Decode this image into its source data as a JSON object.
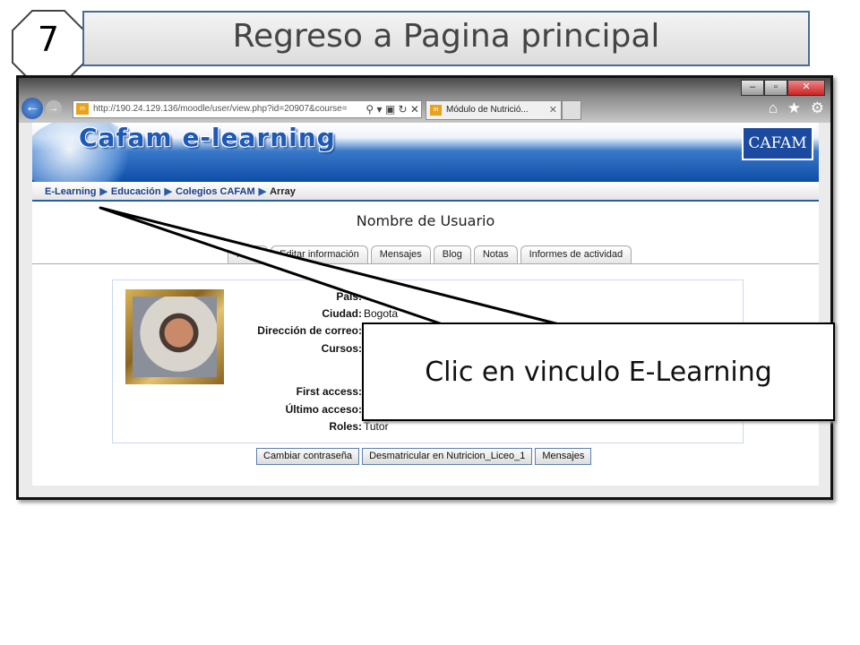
{
  "slide": {
    "step_number": "7",
    "title": "Regreso a Pagina principal",
    "callout": "Clic en vinculo E-Learning"
  },
  "browser": {
    "address": "http://190.24.129.136/moodle/user/view.php?id=20907&course=",
    "address_tools": "⚲ ▾ ▣ ↻ ✕",
    "site_icon": "favicon-icon",
    "tab_title": "Módulo de Nutrició...",
    "tab_close": "✕",
    "back_glyph": "←",
    "forward_glyph": "→",
    "right_tools": "⌂ ★ ⚙",
    "window_buttons": [
      "–",
      "▫",
      "✕"
    ]
  },
  "site": {
    "brand": "Cafam e-learning",
    "logo": "CAFAM",
    "breadcrumb": [
      "E-Learning",
      "Educación",
      "Colegios CAFAM",
      "Array"
    ],
    "breadcrumb_sep": "▶",
    "username": "Nombre de Usuario",
    "tabs": [
      "Perfil",
      "Editar información",
      "Mensajes",
      "Blog",
      "Notas",
      "Informes de actividad"
    ],
    "profile": {
      "fields": [
        {
          "label": "País:",
          "value": "Co"
        },
        {
          "label": "Ciudad:",
          "value": "Bogota"
        },
        {
          "label": "Dirección de correo:",
          "value": ""
        },
        {
          "label": "Cursos:",
          "value": ""
        },
        {
          "label": "First access:",
          "value": ""
        },
        {
          "label": "Último acceso:",
          "value": ""
        },
        {
          "label": "Roles:",
          "value": "Tutor"
        }
      ]
    },
    "buttons": [
      "Cambiar contraseña",
      "Desmatricular en Nutricion_Liceo_1",
      "Mensajes"
    ]
  },
  "colors": {
    "accent": "#2a5ca6",
    "title_border": "#4a6b94"
  }
}
